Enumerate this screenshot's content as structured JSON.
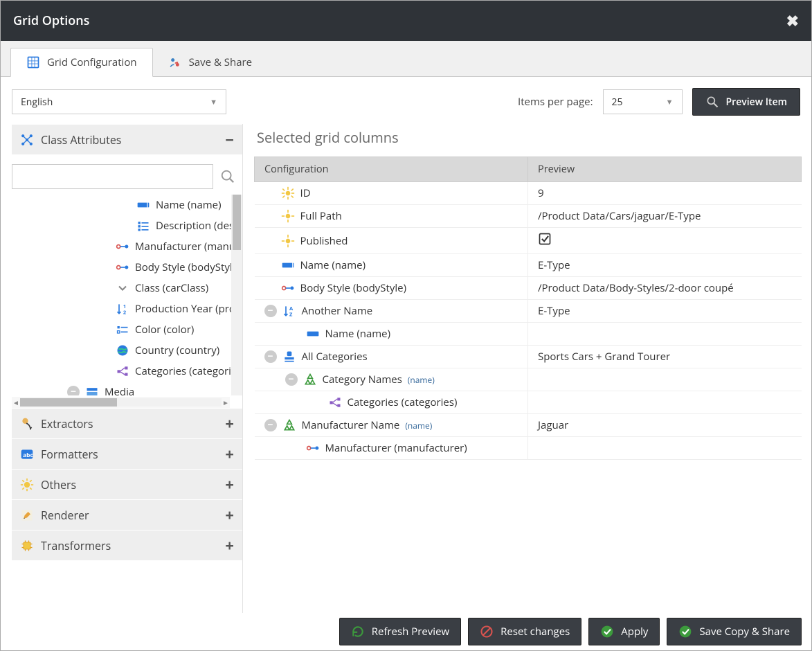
{
  "header": {
    "title": "Grid Options"
  },
  "tabs": {
    "config_label": "Grid Configuration",
    "share_label": "Save & Share"
  },
  "topControls": {
    "language": "English",
    "itemsPerPageLabel": "Items per page:",
    "itemsPerPageValue": "25",
    "previewItemLabel": "Preview Item"
  },
  "leftPane": {
    "classAttributes": "Class Attributes",
    "extractors": "Extractors",
    "formatters": "Formatters",
    "others": "Others",
    "renderer": "Renderer",
    "transformers": "Transformers",
    "treeItems": {
      "name": "Name (name)",
      "description": "Description (description)",
      "manufacturer": "Manufacturer (manufacturer)",
      "bodyStyle": "Body Style (bodyStyle)",
      "carClass": "Class (carClass)",
      "productionYear": "Production Year (productionYear)",
      "color": "Color (color)",
      "country": "Country (country)",
      "categories": "Categories (categories)",
      "media": "Media"
    }
  },
  "rightPane": {
    "title": "Selected grid columns",
    "columns": {
      "config": "Configuration",
      "preview": "Preview"
    },
    "rows": {
      "id_label": "ID",
      "id_value": "9",
      "fullpath_label": "Full Path",
      "fullpath_value": "/Product Data/Cars/jaguar/E-Type",
      "published_label": "Published",
      "name_label": "Name (name)",
      "name_value": "E-Type",
      "bodystyle_label": "Body Style (bodyStyle)",
      "bodystyle_value": "/Product Data/Body-Styles/2-door coupé",
      "anothername_label": "Another Name",
      "anothername_hint": "",
      "anothername_value": "E-Type",
      "namename_label": "Name (name)",
      "allcat_label": "All Categories",
      "allcat_value": "Sports Cars + Grand Tourer",
      "catnames_label": "Category Names",
      "catnames_hint": "(name)",
      "categories_label": "Categories (categories)",
      "mfgname_label": "Manufacturer Name",
      "mfgname_hint": "(name)",
      "mfgname_value": "Jaguar",
      "mfg_label": "Manufacturer (manufacturer)"
    }
  },
  "footer": {
    "refresh": "Refresh Preview",
    "reset": "Reset changes",
    "apply": "Apply",
    "save": "Save Copy & Share"
  }
}
